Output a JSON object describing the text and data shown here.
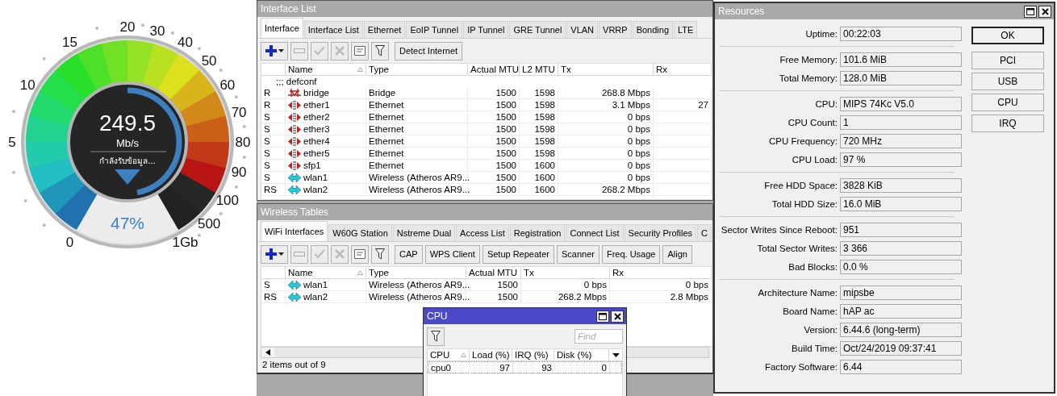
{
  "gauge": {
    "ticks": [
      "0",
      "5",
      "10",
      "15",
      "20",
      "30",
      "40",
      "50",
      "60",
      "70",
      "80",
      "90",
      "100",
      "500",
      "1Gb"
    ],
    "value": "249.5",
    "unit": "Mb/s",
    "status": "กำลังรับข้อมูล...",
    "percent": "47%",
    "level": 0.47
  },
  "interface_list": {
    "title": "Interface List",
    "tabs": [
      {
        "label": "Interface",
        "selected": true
      },
      {
        "label": "Interface List",
        "selected": false
      },
      {
        "label": "Ethernet",
        "selected": false
      },
      {
        "label": "EoIP Tunnel",
        "selected": false
      },
      {
        "label": "IP Tunnel",
        "selected": false
      },
      {
        "label": "GRE Tunnel",
        "selected": false
      },
      {
        "label": "VLAN",
        "selected": false
      },
      {
        "label": "VRRP",
        "selected": false
      },
      {
        "label": "Bonding",
        "selected": false
      },
      {
        "label": "LTE",
        "selected": false
      }
    ],
    "toolbar_buttons": [
      "Detect Internet"
    ],
    "columns": [
      "Name",
      "Type",
      "Actual MTU",
      "L2 MTU",
      "Tx",
      "Rx"
    ],
    "comment": ";;; defconf",
    "rows": [
      {
        "flags": "R",
        "kind": "bridge",
        "name": "bridge",
        "type": "Bridge",
        "actual_mtu": "1500",
        "l2_mtu": "1598",
        "tx": "268.8 Mbps"
      },
      {
        "flags": "R",
        "kind": "ethernet",
        "name": "ether1",
        "type": "Ethernet",
        "actual_mtu": "1500",
        "l2_mtu": "1598",
        "tx": "3.1 Mbps",
        "rx": "27"
      },
      {
        "flags": "S",
        "kind": "ethernet",
        "name": "ether2",
        "type": "Ethernet",
        "actual_mtu": "1500",
        "l2_mtu": "1598",
        "tx": "0 bps"
      },
      {
        "flags": "S",
        "kind": "ethernet",
        "name": "ether3",
        "type": "Ethernet",
        "actual_mtu": "1500",
        "l2_mtu": "1598",
        "tx": "0 bps"
      },
      {
        "flags": "S",
        "kind": "ethernet",
        "name": "ether4",
        "type": "Ethernet",
        "actual_mtu": "1500",
        "l2_mtu": "1598",
        "tx": "0 bps"
      },
      {
        "flags": "S",
        "kind": "ethernet",
        "name": "ether5",
        "type": "Ethernet",
        "actual_mtu": "1500",
        "l2_mtu": "1598",
        "tx": "0 bps"
      },
      {
        "flags": "S",
        "kind": "ethernet",
        "name": "sfp1",
        "type": "Ethernet",
        "actual_mtu": "1500",
        "l2_mtu": "1600",
        "tx": "0 bps"
      },
      {
        "flags": "S",
        "kind": "wireless",
        "name": "wlan1",
        "type": "Wireless (Atheros AR9...",
        "actual_mtu": "1500",
        "l2_mtu": "1600",
        "tx": "0 bps"
      },
      {
        "flags": "RS",
        "kind": "wireless",
        "name": "wlan2",
        "type": "Wireless (Atheros AR9...",
        "actual_mtu": "1500",
        "l2_mtu": "1600",
        "tx": "268.2 Mbps"
      }
    ]
  },
  "wireless_tables": {
    "title": "Wireless Tables",
    "tabs": [
      {
        "label": "WiFi Interfaces",
        "selected": true
      },
      {
        "label": "W60G Station",
        "selected": false
      },
      {
        "label": "Nstreme Dual",
        "selected": false
      },
      {
        "label": "Access List",
        "selected": false
      },
      {
        "label": "Registration",
        "selected": false
      },
      {
        "label": "Connect List",
        "selected": false
      },
      {
        "label": "Security Profiles",
        "selected": false
      },
      {
        "label": "C",
        "selected": false
      }
    ],
    "toolbar_buttons": [
      "CAP",
      "WPS Client",
      "Setup Repeater",
      "Scanner",
      "Freq. Usage",
      "Align"
    ],
    "columns": [
      "Name",
      "Type",
      "Actual MTU",
      "Tx",
      "Rx"
    ],
    "rows": [
      {
        "flags": "S",
        "kind": "wireless",
        "name": "wlan1",
        "type": "Wireless (Atheros AR9...",
        "actual_mtu": "1500",
        "tx": "0 bps",
        "rx": "0 bps"
      },
      {
        "flags": "RS",
        "kind": "wireless",
        "name": "wlan2",
        "type": "Wireless (Atheros AR9...",
        "actual_mtu": "1500",
        "tx": "268.2 Mbps",
        "rx": "2.8 Mbps"
      }
    ],
    "status": "2 items out of 9"
  },
  "cpu_window": {
    "title": "CPU",
    "find_placeholder": "Find",
    "columns": [
      "CPU",
      "Load (%)",
      "IRQ (%)",
      "Disk (%)"
    ],
    "rows": [
      {
        "cpu": "cpu0",
        "load": "97",
        "irq": "93",
        "disk": "0"
      }
    ]
  },
  "resources": {
    "title": "Resources",
    "groups": [
      [
        {
          "label": "Uptime:",
          "value": "00:22:03"
        }
      ],
      [
        {
          "label": "Free Memory:",
          "value": "101.6 MiB"
        },
        {
          "label": "Total Memory:",
          "value": "128.0 MiB"
        }
      ],
      [
        {
          "label": "CPU:",
          "value": "MIPS 74Kc V5.0"
        },
        {
          "label": "CPU Count:",
          "value": "1"
        },
        {
          "label": "CPU Frequency:",
          "value": "720 MHz"
        },
        {
          "label": "CPU Load:",
          "value": "97 %"
        }
      ],
      [
        {
          "label": "Free HDD Space:",
          "value": "3828 KiB"
        },
        {
          "label": "Total HDD Size:",
          "value": "16.0 MiB"
        }
      ],
      [
        {
          "label": "Sector Writes Since Reboot:",
          "value": "951"
        },
        {
          "label": "Total Sector Writes:",
          "value": "3 366"
        },
        {
          "label": "Bad Blocks:",
          "value": "0.0 %"
        }
      ],
      [
        {
          "label": "Architecture Name:",
          "value": "mipsbe"
        },
        {
          "label": "Board Name:",
          "value": "hAP ac"
        },
        {
          "label": "Version:",
          "value": "6.44.6 (long-term)"
        },
        {
          "label": "Build Time:",
          "value": "Oct/24/2019 09:37:41"
        },
        {
          "label": "Factory Software:",
          "value": "6.44"
        }
      ]
    ],
    "buttons": [
      {
        "label": "OK",
        "default": true
      },
      {
        "label": "PCI",
        "default": false
      },
      {
        "label": "USB",
        "default": false
      },
      {
        "label": "CPU",
        "default": false
      },
      {
        "label": "IRQ",
        "default": false
      }
    ]
  }
}
